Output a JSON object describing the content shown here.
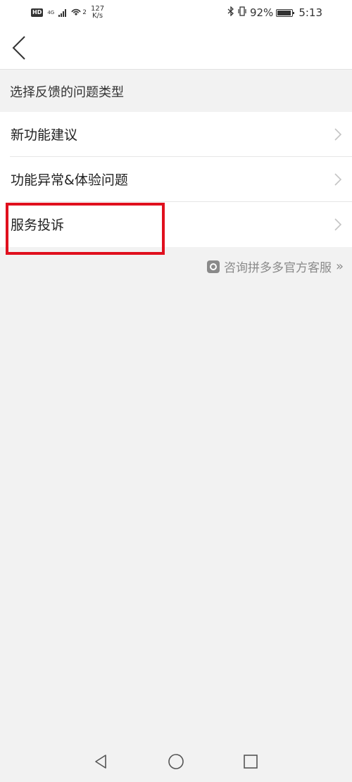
{
  "status_bar": {
    "hd": "HD",
    "net_top": "4G",
    "net_bottom": "4G",
    "wifi_badge": "2",
    "speed_value": "127",
    "speed_unit": "K/s",
    "bluetooth_icon": "bluetooth-icon",
    "battery_percent": "92%",
    "battery_level": 0.92,
    "time": "5:13"
  },
  "header": {
    "back_icon": "chevron-left-icon"
  },
  "section": {
    "title": "选择反馈的问题类型"
  },
  "menu": {
    "items": [
      {
        "label": "新功能建议",
        "icon": "chevron-right-icon"
      },
      {
        "label": "功能异常&体验问题",
        "icon": "chevron-right-icon"
      },
      {
        "label": "服务投诉",
        "icon": "chevron-right-icon"
      }
    ]
  },
  "customer_service": {
    "label": "咨询拼多多官方客服",
    "arrows": "»",
    "icon": "customer-service-icon"
  },
  "colors": {
    "highlight": "#e0101e",
    "background": "#f2f2f2",
    "muted_text": "#8a8a8a"
  }
}
